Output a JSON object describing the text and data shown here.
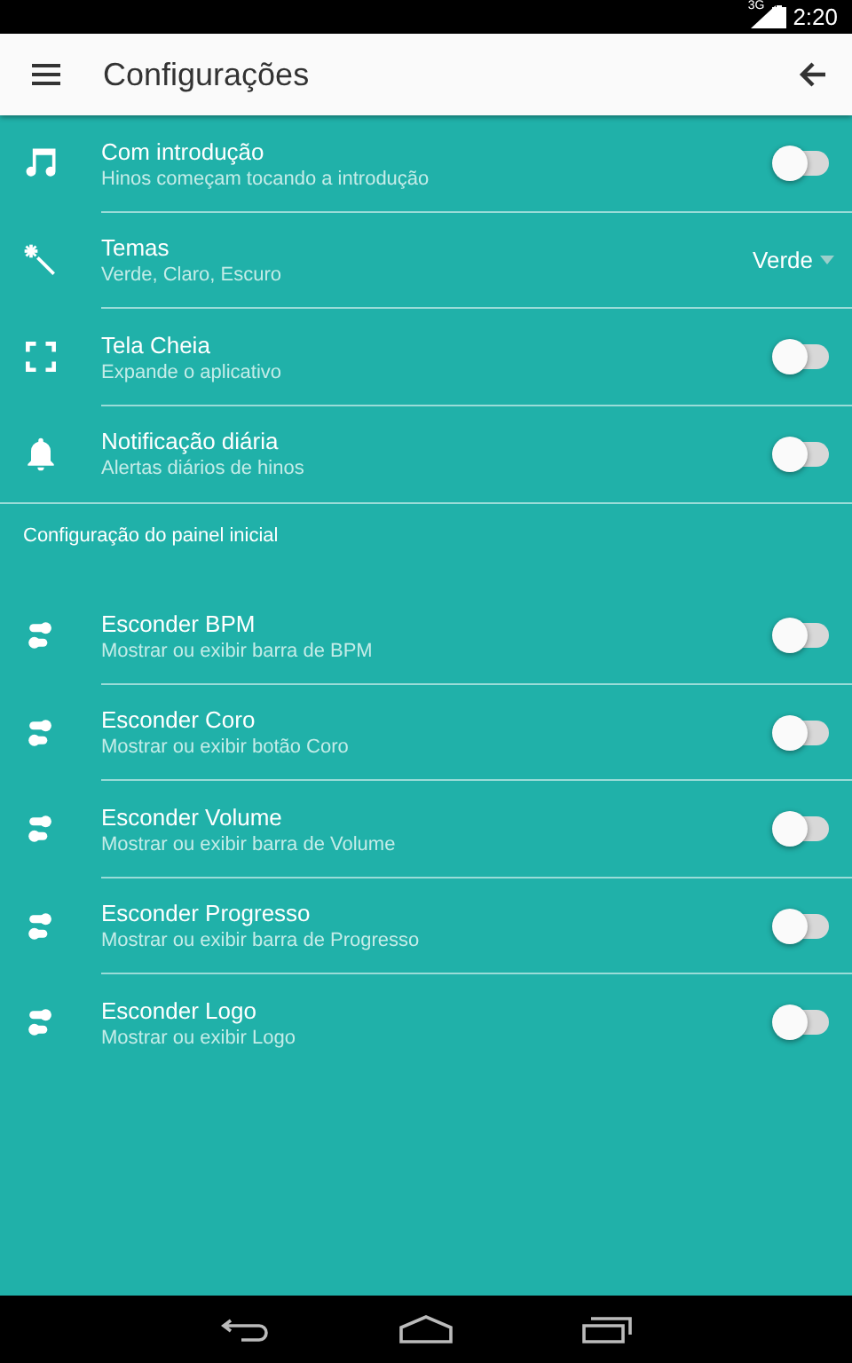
{
  "status_bar": {
    "network": "3G",
    "time": "2:20"
  },
  "app_bar": {
    "title": "Configurações"
  },
  "sections": [
    {
      "items": [
        {
          "kind": "toggle",
          "title": "Com introdução",
          "subtitle": "Hinos começam tocando a introdução",
          "on": false
        },
        {
          "kind": "dropdown",
          "title": "Temas",
          "subtitle": "Verde, Claro, Escuro",
          "value": "Verde"
        },
        {
          "kind": "toggle",
          "title": "Tela Cheia",
          "subtitle": "Expande o aplicativo",
          "on": false
        },
        {
          "kind": "toggle",
          "title": "Notificação diária",
          "subtitle": "Alertas diários de hinos",
          "on": false
        }
      ]
    },
    {
      "header": "Configuração do painel inicial",
      "items": [
        {
          "kind": "toggle",
          "title": "Esconder BPM",
          "subtitle": "Mostrar ou exibir barra de BPM",
          "on": false
        },
        {
          "kind": "toggle",
          "title": "Esconder Coro",
          "subtitle": "Mostrar ou exibir botão Coro",
          "on": false
        },
        {
          "kind": "toggle",
          "title": "Esconder Volume",
          "subtitle": "Mostrar ou exibir barra de Volume",
          "on": false
        },
        {
          "kind": "toggle",
          "title": "Esconder Progresso",
          "subtitle": "Mostrar ou exibir barra de Progresso",
          "on": false
        },
        {
          "kind": "toggle",
          "title": "Esconder Logo",
          "subtitle": "Mostrar ou exibir Logo",
          "on": false
        }
      ]
    }
  ]
}
